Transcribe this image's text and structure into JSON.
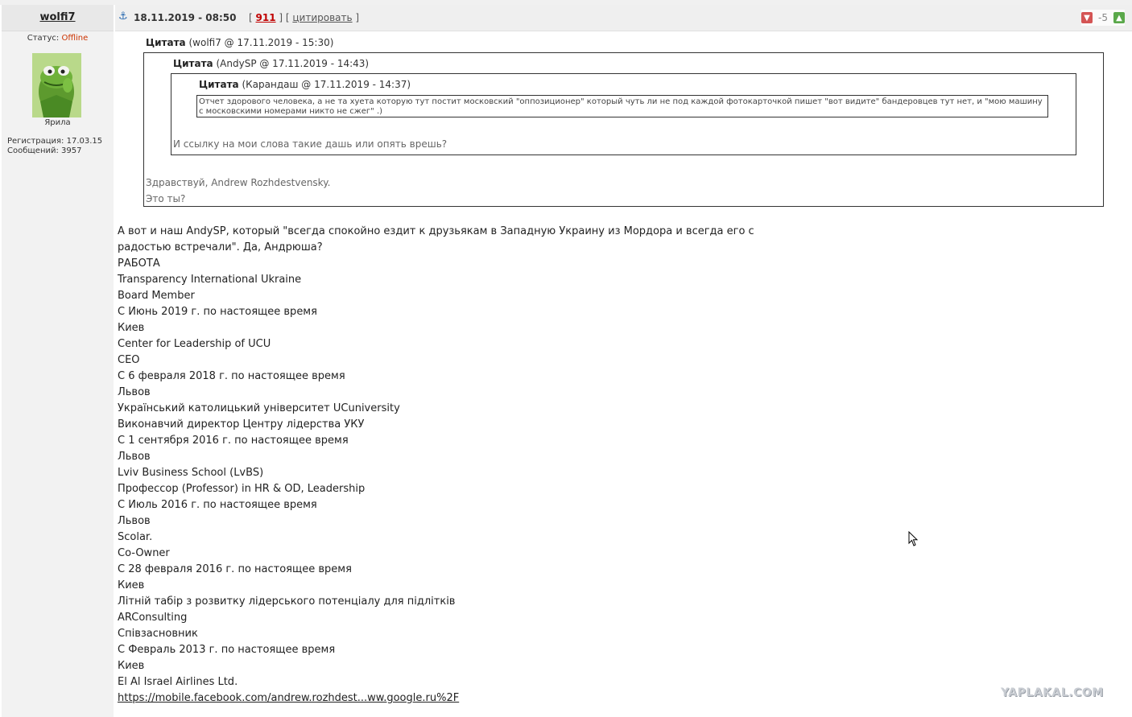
{
  "post": {
    "username": "wolfi7",
    "status_label": "Статус:",
    "status_value": "Offline",
    "user_title": "Ярила",
    "registration": "Регистрация: 17.03.15",
    "messages": "Сообщений: 3957",
    "date": "18.11.2019 - 08:50",
    "post_number": "911",
    "quote_action": "цитировать",
    "rating": "-5"
  },
  "quotes": {
    "q1": {
      "label": "Цитата",
      "meta": "(wolfi7 @ 17.11.2019 - 15:30)",
      "text_lines": [
        "Здравствуй, Andrew Rozhdestvensky.",
        "Это ты?"
      ]
    },
    "q2": {
      "label": "Цитата",
      "meta": "(AndySP @ 17.11.2019 - 14:43)",
      "text": "И ссылку на мои слова такие дашь или опять врешь?"
    },
    "q3": {
      "label": "Цитата",
      "meta": "(Карандаш @ 17.11.2019 - 14:37)",
      "text": "Отчет здорового человека, а не та хуета которую тут постит московский \"оппозиционер\" который чуть ли не под каждой фотокарточкой пишет \"вот видите\"  бандеровцев тут нет, и \"мою машину с московскими номерами никто не сжег\" .)"
    }
  },
  "body": {
    "lines": [
      "А вот и наш AndySP, который \"всегда спокойно ездит к друзьякам в Западную Украину из Мордора и всегда его с",
      "радостью встречали\". Да, Андрюша?",
      "РАБОТА",
      "Transparency International Ukraine",
      "Board Member",
      "С Июнь 2019 г. по настоящее время",
      "Киев",
      "Center for Leadership of UCU",
      "CEO",
      "С 6 февраля 2018 г. по настоящее время",
      "Львов",
      "Український католицький університет UCuniversity",
      "Виконавчий директор Центру лідерства УКУ",
      "С 1 сентября 2016 г. по настоящее время",
      "Львов",
      "Lviv Business School (LvBS)",
      "Профессор (Professor) in HR & OD, Leadership",
      "С Июль 2016 г. по настоящее время",
      "Львов",
      "Scolar.",
      "Co-Owner",
      "С 28 февраля 2016 г. по настоящее время",
      "Киев",
      "Літній табір з розвитку лідерського потенціалу для підлітків",
      "ARConsulting",
      "Співзасновник",
      "С Февраль 2013 г. по настоящее время",
      "Киев",
      "El Al Israel Airlines Ltd."
    ],
    "link": "https://mobile.facebook.com/andrew.rozhdest...ww.google.ru%2F"
  },
  "watermark": "YAPLAKAL.COM",
  "icons": [
    "anchor-icon",
    "thumb-down-icon",
    "thumb-up-icon",
    "mouse-cursor-icon"
  ]
}
